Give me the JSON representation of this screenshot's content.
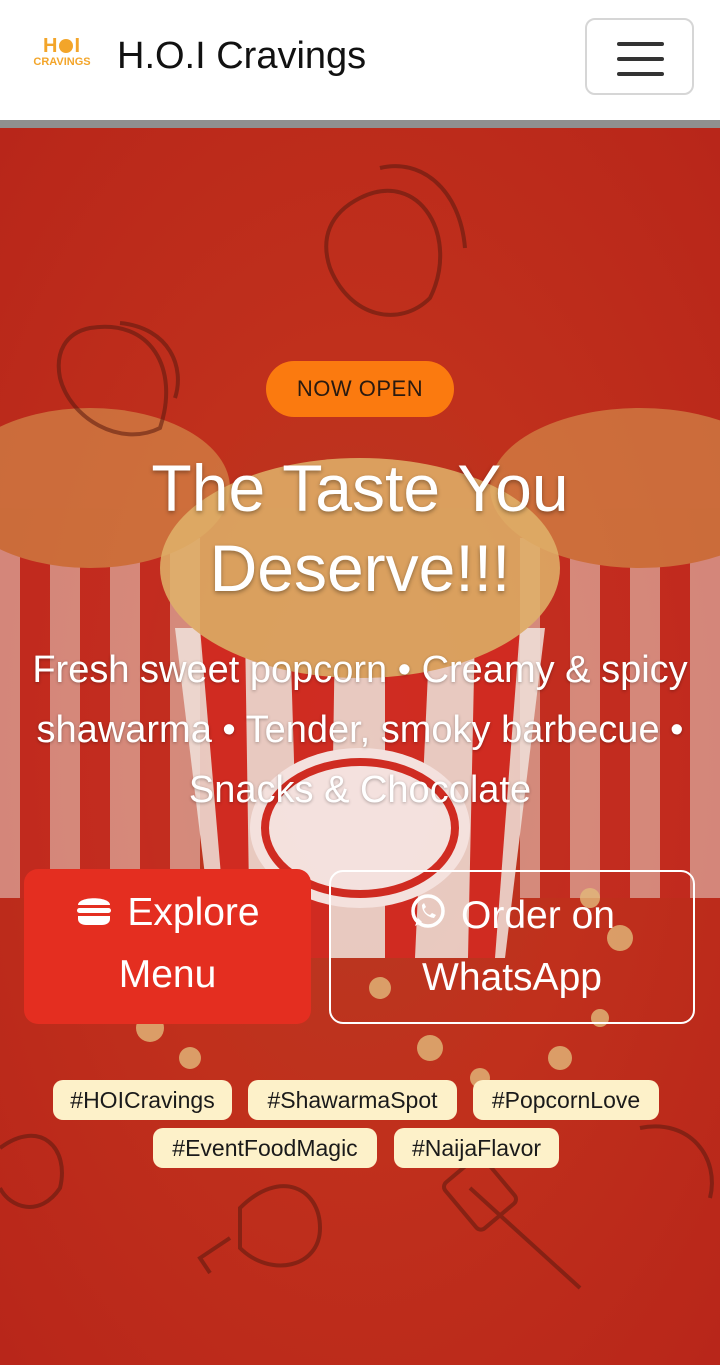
{
  "navbar": {
    "logo_top": "H",
    "logo_bottom": "CRAVINGS",
    "logo_dot": "I",
    "brand_name": "H.O.I Cravings",
    "menu_icon": "hamburger-icon"
  },
  "hero": {
    "badge": "NOW OPEN",
    "headline": "The Taste You Deserve!!!",
    "subtitle": "Fresh sweet popcorn • Creamy & spicy shawarma • Tender, smoky barbecue • Snacks & Chocolate",
    "primary_button": {
      "label": "Explore Menu",
      "icon": "burger-icon"
    },
    "secondary_button": {
      "label": "Order on WhatsApp",
      "icon": "whatsapp-icon"
    },
    "tags": [
      "#HOICravings",
      "#ShawarmaSpot",
      "#PopcornLove",
      "#EventFoodMagic",
      "#NaijaFlavor"
    ]
  },
  "colors": {
    "accent_orange": "#fb7a0f",
    "button_red": "#e42e20",
    "tag_background": "#fdf1c9",
    "logo_gold": "#f3a52a"
  }
}
